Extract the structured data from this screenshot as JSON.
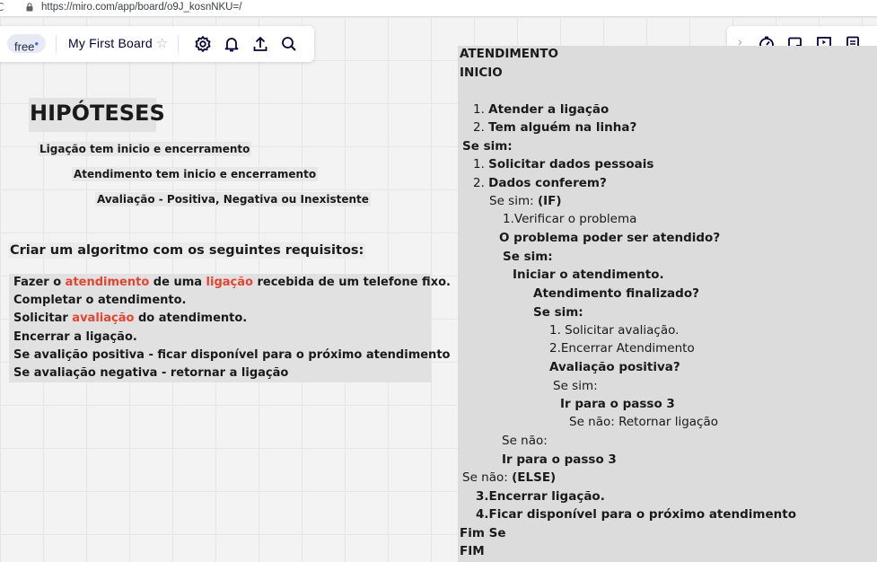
{
  "browser": {
    "url": "https://miro.com/app/board/o9J_kosnNKU=/"
  },
  "toolbar_left": {
    "plan_badge": "free",
    "board_name": "My First Board",
    "icons": [
      "star-icon",
      "settings-icon",
      "bell-icon",
      "share-upload-icon",
      "search-icon"
    ]
  },
  "toolbar_right": {
    "icons": [
      "chevron-right-icon",
      "timer-icon",
      "card-icon",
      "presentation-icon",
      "notes-icon"
    ]
  },
  "hipoteses": {
    "title": "HIPÓTESES",
    "lines": [
      "Ligação tem inicio e encerramento",
      "Atendimento tem inicio e encerramento",
      "Avaliação  - Positiva, Negativa ou Inexistente"
    ]
  },
  "requisitos": {
    "title": "Criar um algoritmo com os seguintes requisitos:",
    "line1": {
      "p1": "Fazer o ",
      "h1": "atendimento",
      "p2": " de uma ",
      "h2": "ligação",
      "p3": " recebida de um telefone fixo."
    },
    "line2": "Completar o atendimento.",
    "line3": {
      "p1": "Solicitar ",
      "h1": "avaliação",
      "p2": " do atendimento."
    },
    "line4": "Encerrar a ligação.",
    "line5": "Se avalição positiva - ficar disponível para o próximo atendimento",
    "line6": "Se avaliação negativa - retornar a ligação",
    "highlight_color": "#e2452f"
  },
  "algoritmo": {
    "l1": "ATENDIMENTO",
    "l2": "INICIO",
    "l3n": "1. ",
    "l3b": "Atender a ligação",
    "l4n": "2. ",
    "l4b": "Tem alguém na linha?",
    "l5": "Se sim:",
    "l6n": "1. ",
    "l6b": "Solicitar dados pessoais",
    "l7n": "2. ",
    "l7b": "Dados conferem?",
    "l8n": "Se sim: ",
    "l8b": "(IF)",
    "l9": "1.Verificar o problema",
    "l10": "O problema poder ser atendido?",
    "l11": "Se sim:",
    "l12": "Iniciar o atendimento.",
    "l13": "Atendimento finalizado?",
    "l14": "Se sim:",
    "l15": "1. Solicitar avaliação.",
    "l16": "2.Encerrar Atendimento",
    "l17": "Avaliação positiva?",
    "l18": "Se sim:",
    "l19": "Ir para o passo 3",
    "l20": "Se não: Retornar ligação",
    "l21": "Se não:",
    "l22": "Ir para o passo 3",
    "l23n": "Se não: ",
    "l23b": "(ELSE)",
    "l24": "3.Encerrar ligação.",
    "l25": "4.Ficar disponível para o próximo atendimento",
    "l26": "Fim Se",
    "l27": "FIM"
  }
}
